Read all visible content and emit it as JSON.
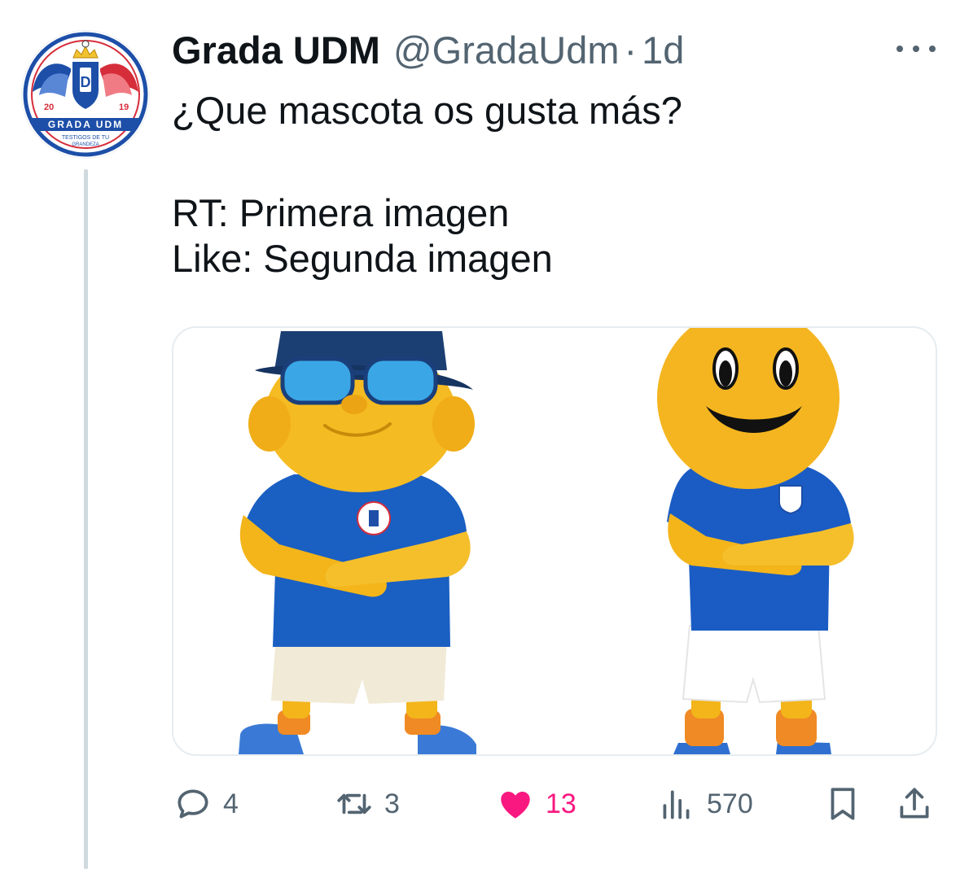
{
  "author": {
    "display_name": "Grada UDM",
    "handle": "@GradaUdm",
    "separator": "·",
    "time": "1d",
    "avatar": {
      "top_text": "GRADA UDM",
      "year_left": "20",
      "year_right": "19",
      "motto_line1": "TESTIGOS DE TU",
      "motto_line2": "GRANDEZA",
      "shield_letter": "D"
    }
  },
  "tweet": {
    "line1": "¿Que mascota os gusta más?",
    "line2": "RT: Primera imagen",
    "line3": "Like: Segunda imagen"
  },
  "media": {
    "images": [
      {
        "alt": "yellow mascot with bucket hat and sunglasses"
      },
      {
        "alt": "yellow smiley-face mascot"
      }
    ]
  },
  "actions": {
    "replies": "4",
    "retweets": "3",
    "likes": "13",
    "views": "570"
  },
  "icons": {
    "reply": "reply-icon",
    "retweet": "retweet-icon",
    "like": "heart-icon",
    "views": "views-icon",
    "bookmark": "bookmark-icon",
    "share": "share-icon",
    "more": "more-icon"
  },
  "colors": {
    "text": "#0f1419",
    "secondary": "#536471",
    "like": "#f91880",
    "thread_line": "#cfd9de",
    "brand_blue": "#1d4fa8",
    "brand_red": "#d62d3a"
  }
}
